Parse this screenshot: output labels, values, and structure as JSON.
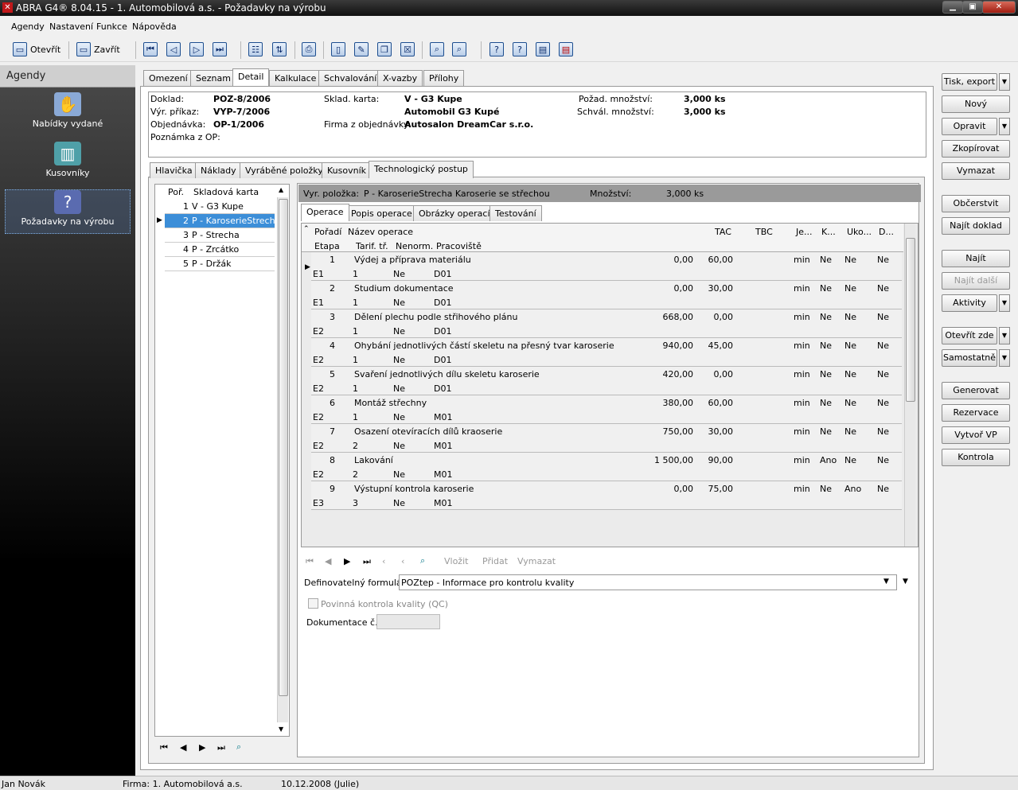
{
  "window": {
    "title": "ABRA G4® 8.04.15 - 1. Automobilová a.s. - Požadavky na výrobu",
    "buttons": [
      "▁",
      "▣",
      "✕"
    ]
  },
  "menu": [
    "Agendy",
    "Nastavení",
    "Funkce",
    "Nápověda"
  ],
  "toolbar": {
    "open": "Otevřít",
    "close": "Zavřít"
  },
  "agendy": {
    "header": "Agendy",
    "items": [
      "Nabídky vydané",
      "Kusovníky",
      "Požadavky na výrobu"
    ]
  },
  "tabs": [
    "Omezení",
    "Seznam",
    "Detail",
    "Kalkulace",
    "Schvalování",
    "X-vazby",
    "Přílohy"
  ],
  "header": {
    "doklad_l": "Doklad:",
    "doklad_v": "POZ-8/2006",
    "vyrprikaz_l": "Výr. příkaz:",
    "vyrprikaz_v": "VYP-7/2006",
    "objednavka_l": "Objednávka:",
    "objednavka_v": "OP-1/2006",
    "poznamka_l": "Poznámka z OP:",
    "skladkarta_l": "Sklad. karta:",
    "skladkarta_v1": "V - G3 Kupe",
    "skladkarta_v2": "Automobil G3 Kupé",
    "firma_l": "Firma z objednávky:",
    "firma_v": "Autosalon DreamCar s.r.o.",
    "pozad_l": "Požad. množství:",
    "pozad_v": "3,000 ks",
    "schval_l": "Schvál. množství:",
    "schval_v": "3,000 ks"
  },
  "subtabs": [
    "Hlavička",
    "Náklady",
    "Vyráběné položky",
    "Kusovník",
    "Technologický postup"
  ],
  "leftlist": {
    "col1": "Poř.",
    "col2": "Skladová karta",
    "rows": [
      {
        "n": "1",
        "t": "V - G3 Kupe"
      },
      {
        "n": "2",
        "t": "P - KaroserieStrecha"
      },
      {
        "n": "3",
        "t": "P - Strecha"
      },
      {
        "n": "4",
        "t": "P - Zrcátko"
      },
      {
        "n": "5",
        "t": "P - Držák"
      }
    ]
  },
  "vyrpolozka": {
    "label": "Vyr. položka:",
    "value": "P - KaroserieStrecha Karoserie se střechou",
    "mn_label": "Množství:",
    "mn_value": "3,000  ks"
  },
  "optabs": [
    "Operace",
    "Popis operace",
    "Obrázky operací",
    "Testování"
  ],
  "grid": {
    "headers1": {
      "poradi": "Pořadí",
      "nazev": "Název operace",
      "tac": "TAC",
      "tbc": "TBC",
      "je": "Je...",
      "k": "K...",
      "uko": "Uko...",
      "d": "D..."
    },
    "headers2": {
      "etapa": "Etapa",
      "tarif": "Tarif. tř.",
      "nenorm": "Nenorm.",
      "prac": "Pracoviště"
    },
    "rows": [
      {
        "p": "1",
        "n": "Výdej a příprava materiálu",
        "tac": "0,00",
        "tbc": "60,00",
        "je": "min",
        "k": "Ne",
        "u": "Ne",
        "d": "Ne",
        "e": "E1",
        "tt": "1",
        "nn": "Ne",
        "pr": "D01"
      },
      {
        "p": "2",
        "n": "Studium dokumentace",
        "tac": "0,00",
        "tbc": "30,00",
        "je": "min",
        "k": "Ne",
        "u": "Ne",
        "d": "Ne",
        "e": "E1",
        "tt": "1",
        "nn": "Ne",
        "pr": "D01"
      },
      {
        "p": "3",
        "n": "Dělení plechu podle střihového plánu",
        "tac": "668,00",
        "tbc": "0,00",
        "je": "min",
        "k": "Ne",
        "u": "Ne",
        "d": "Ne",
        "e": "E2",
        "tt": "1",
        "nn": "Ne",
        "pr": "D01"
      },
      {
        "p": "4",
        "n": "Ohybání jednotlivých částí skeletu na přesný tvar karoserie",
        "tac": "940,00",
        "tbc": "45,00",
        "je": "min",
        "k": "Ne",
        "u": "Ne",
        "d": "Ne",
        "e": "E2",
        "tt": "1",
        "nn": "Ne",
        "pr": "D01"
      },
      {
        "p": "5",
        "n": "Svaření jednotlivých dílu skeletu karoserie",
        "tac": "420,00",
        "tbc": "0,00",
        "je": "min",
        "k": "Ne",
        "u": "Ne",
        "d": "Ne",
        "e": "E2",
        "tt": "1",
        "nn": "Ne",
        "pr": "D01"
      },
      {
        "p": "6",
        "n": "Montáž střechny",
        "tac": "380,00",
        "tbc": "60,00",
        "je": "min",
        "k": "Ne",
        "u": "Ne",
        "d": "Ne",
        "e": "E2",
        "tt": "1",
        "nn": "Ne",
        "pr": "M01"
      },
      {
        "p": "7",
        "n": "Osazení otevíracích dílů kraoserie",
        "tac": "750,00",
        "tbc": "30,00",
        "je": "min",
        "k": "Ne",
        "u": "Ne",
        "d": "Ne",
        "e": "E2",
        "tt": "2",
        "nn": "Ne",
        "pr": "M01"
      },
      {
        "p": "8",
        "n": "Lakování",
        "tac": "1 500,00",
        "tbc": "90,00",
        "je": "min",
        "k": "Ano",
        "u": "Ne",
        "d": "Ne",
        "e": "E2",
        "tt": "2",
        "nn": "Ne",
        "pr": "M01"
      },
      {
        "p": "9",
        "n": "Výstupní kontrola karoserie",
        "tac": "0,00",
        "tbc": "75,00",
        "je": "min",
        "k": "Ne",
        "u": "Ano",
        "d": "Ne",
        "e": "E3",
        "tt": "3",
        "nn": "Ne",
        "pr": "M01"
      }
    ]
  },
  "gridnav": {
    "vlozit": "Vložit",
    "pridat": "Přidat",
    "vymazat": "Vymazat"
  },
  "form": {
    "label": "Definovatelný formulář:",
    "value": "POZtep - Informace pro kontrolu kvality",
    "checkbox": "Povinná kontrola kvality (QC)",
    "dok_label": "Dokumentace č.:"
  },
  "rightbuttons": [
    "Tisk, export",
    "Nový",
    "Opravit",
    "Zkopírovat",
    "Vymazat",
    "Občerstvit",
    "Najít doklad",
    "Najít",
    "Najít další",
    "Aktivity",
    "Otevřít zde",
    "Samostatně",
    "Generovat",
    "Rezervace",
    "Vytvoř VP",
    "Kontrola"
  ],
  "status": {
    "user": "Jan Novák",
    "firma": "Firma: 1. Automobilová a.s.",
    "date": "10.12.2008 (Julie)"
  }
}
